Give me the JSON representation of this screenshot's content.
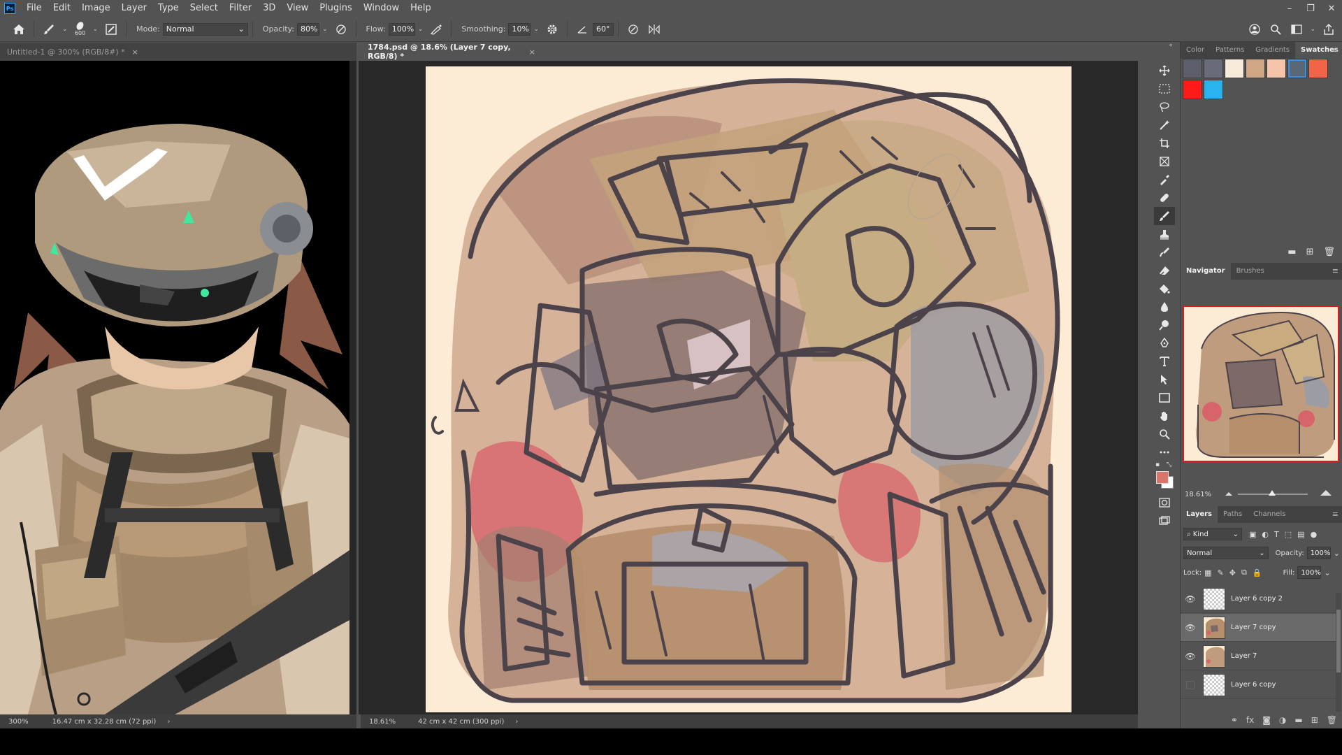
{
  "app": {
    "logo": "Ps"
  },
  "menu": [
    "File",
    "Edit",
    "Image",
    "Layer",
    "Type",
    "Select",
    "Filter",
    "3D",
    "View",
    "Plugins",
    "Window",
    "Help"
  ],
  "window_controls": {
    "minimize": "–",
    "restore": "❐",
    "close": "✕"
  },
  "options": {
    "brush_size": "600",
    "mode_label": "Mode:",
    "mode_value": "Normal",
    "opacity_label": "Opacity:",
    "opacity_value": "80%",
    "flow_label": "Flow:",
    "flow_value": "100%",
    "smoothing_label": "Smoothing:",
    "smoothing_value": "10%",
    "angle_value": "60°"
  },
  "tabs": [
    {
      "title": "Untitled-1 @ 300% (RGB/8#) *",
      "close": "×"
    },
    {
      "title": "1784.psd @ 18.6% (Layer 7 copy, RGB/8) *",
      "close": "×"
    }
  ],
  "status_left": {
    "zoom": "300%",
    "info": "16.47 cm x 32.28 cm (72 ppi)",
    "arrow": "›"
  },
  "status_main": {
    "zoom": "18.61%",
    "info": "42 cm x 42 cm (300 ppi)",
    "arrow": "›"
  },
  "tools": [
    "move-tool",
    "marquee-tool",
    "lasso-tool",
    "magic-wand-tool",
    "crop-tool",
    "frame-tool",
    "eyedropper-tool",
    "healing-tool",
    "brush-tool",
    "stamp-tool",
    "history-brush-tool",
    "eraser-tool",
    "paint-bucket-tool",
    "blur-tool",
    "dodge-tool",
    "pen-tool",
    "type-tool",
    "path-select-tool",
    "rectangle-tool",
    "hand-tool",
    "zoom-tool",
    "more-tools"
  ],
  "colors": {
    "foreground": "#d9766b",
    "background": "#ffffff",
    "canvas": "#fcebd5",
    "selection_blue": "#3b8fe0"
  },
  "swatches_panel": {
    "tabs": [
      "Color",
      "Patterns",
      "Gradients",
      "Swatches"
    ],
    "active": "Swatches",
    "swatches": [
      "#5c5f6b",
      "#686b78",
      "#f7ecd9",
      "#cfa784",
      "#f6c4a8",
      "#5c6775",
      "#f16447",
      "#ff1a1a",
      "#29b4ef"
    ],
    "selected_index": 5
  },
  "navigator_panel": {
    "tabs": [
      "Navigator",
      "Brushes"
    ],
    "active": "Navigator",
    "zoom": "18.61%"
  },
  "layers_panel": {
    "tabs": [
      "Layers",
      "Paths",
      "Channels"
    ],
    "active": "Layers",
    "filter_kind": "Kind",
    "blend_mode": "Normal",
    "opacity_label": "Opacity:",
    "opacity_value": "100%",
    "lock_label": "Lock:",
    "fill_label": "Fill:",
    "fill_value": "100%",
    "layers": [
      {
        "name": "Layer 6 copy 2",
        "visible": true,
        "selected": false,
        "thumb": "transparent"
      },
      {
        "name": "Layer 7 copy",
        "visible": true,
        "selected": true,
        "thumb": "art"
      },
      {
        "name": "Layer 7",
        "visible": true,
        "selected": false,
        "thumb": "art"
      },
      {
        "name": "Layer 6 copy",
        "visible": false,
        "selected": false,
        "thumb": "transparent"
      }
    ]
  }
}
